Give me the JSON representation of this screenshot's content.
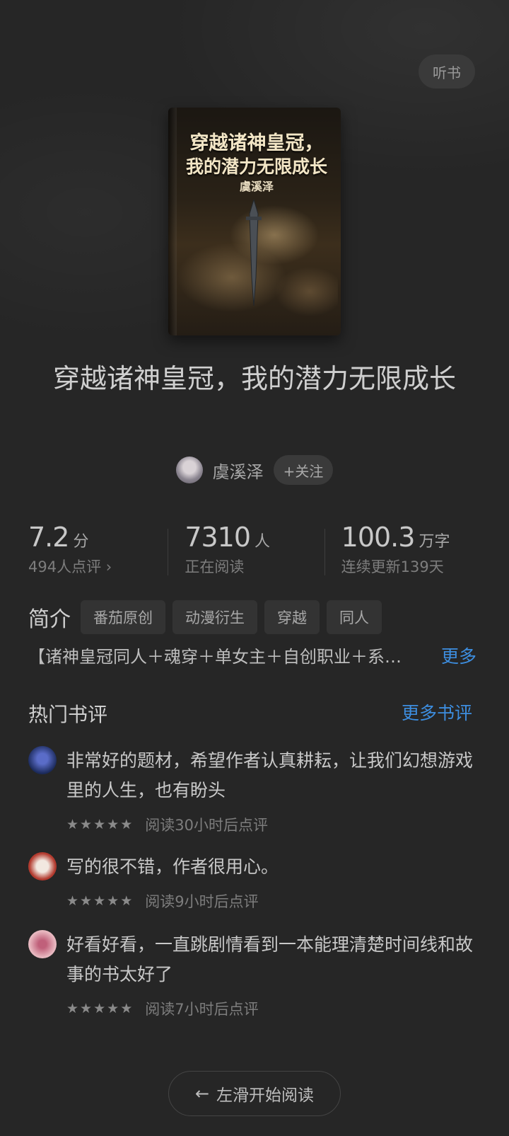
{
  "header": {
    "listen_label": "听书"
  },
  "cover": {
    "title_line1": "穿越诸神皇冠，",
    "title_line2": "我的潜力无限成长",
    "author": "虞溪泽"
  },
  "book": {
    "title": "穿越诸神皇冠，我的潜力无限成长",
    "author": "虞溪泽",
    "follow_label": "+关注"
  },
  "stats": [
    {
      "value": "7.2",
      "unit": "分",
      "sub": "494人点评 ›"
    },
    {
      "value": "7310",
      "unit": "人",
      "sub": "正在阅读"
    },
    {
      "value": "100.3",
      "unit": "万字",
      "sub": "连续更新139天"
    }
  ],
  "intro": {
    "label": "简介",
    "tags": [
      "番茄原创",
      "动漫衍生",
      "穿越",
      "同人"
    ],
    "text": "【诸神皇冠同人＋魂穿＋单女主＋自创职业＋系统】",
    "more_label": "更多"
  },
  "reviews_section": {
    "title": "热门书评",
    "more_label": "更多书评",
    "items": [
      {
        "text": "非常好的题材，希望作者认真耕耘，让我们幻想游戏里的人生，也有盼头",
        "stars": 5,
        "time": "阅读30小时后点评",
        "avatar_color": "#1b2a5a"
      },
      {
        "text": "写的很不错，作者很用心。",
        "stars": 5,
        "time": "阅读9小时后点评",
        "avatar_color": "#b23a2e"
      },
      {
        "text": "好看好看，一直跳剧情看到一本能理清楚时间线和故事的书太好了",
        "stars": 5,
        "time": "阅读7小时后点评",
        "avatar_color": "#e8b8c0"
      }
    ]
  },
  "footer": {
    "start_label": "左滑开始阅读",
    "arrow_icon": "arrow-left-icon"
  }
}
